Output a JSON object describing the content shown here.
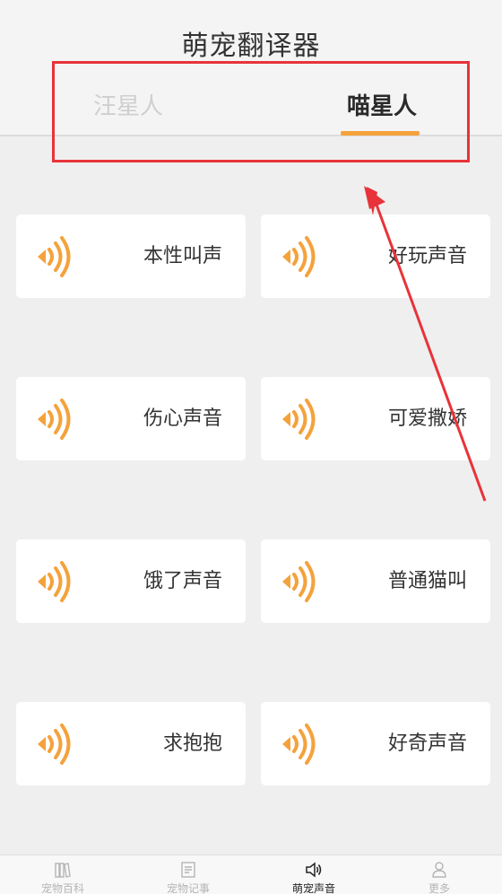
{
  "header": {
    "title": "萌宠翻译器",
    "tabs": [
      {
        "label": "汪星人",
        "active": false
      },
      {
        "label": "喵星人",
        "active": true
      }
    ]
  },
  "sounds": [
    {
      "label": "本性叫声"
    },
    {
      "label": "好玩声音"
    },
    {
      "label": "伤心声音"
    },
    {
      "label": "可爱撒娇"
    },
    {
      "label": "饿了声音"
    },
    {
      "label": "普通猫叫"
    },
    {
      "label": "求抱抱"
    },
    {
      "label": "好奇声音"
    }
  ],
  "bottom_nav": [
    {
      "label": "宠物百科",
      "icon": "books-icon",
      "active": false
    },
    {
      "label": "宠物记事",
      "icon": "notebook-icon",
      "active": false
    },
    {
      "label": "萌宠声音",
      "icon": "speaker-icon",
      "active": true
    },
    {
      "label": "更多",
      "icon": "person-icon",
      "active": false
    }
  ],
  "colors": {
    "accent": "#f4a23c",
    "annotation": "#e8333a",
    "background": "#efefef"
  }
}
